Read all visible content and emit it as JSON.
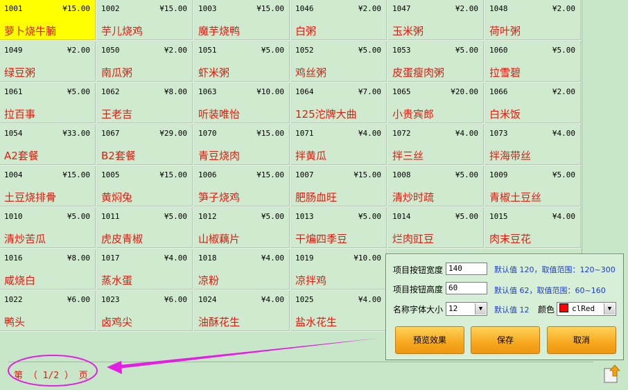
{
  "items": [
    {
      "code": "1001",
      "price": "¥15.00",
      "name": "萝卜烧牛腩",
      "selected": true
    },
    {
      "code": "1002",
      "price": "¥15.00",
      "name": "芋儿烧鸡"
    },
    {
      "code": "1003",
      "price": "¥15.00",
      "name": "魔芋烧鸭"
    },
    {
      "code": "1046",
      "price": "¥2.00",
      "name": "白粥"
    },
    {
      "code": "1047",
      "price": "¥2.00",
      "name": "玉米粥"
    },
    {
      "code": "1048",
      "price": "¥2.00",
      "name": "荷叶粥"
    },
    {
      "code": "1049",
      "price": "¥2.00",
      "name": "绿豆粥"
    },
    {
      "code": "1050",
      "price": "¥2.00",
      "name": "南瓜粥"
    },
    {
      "code": "1051",
      "price": "¥5.00",
      "name": "虾米粥"
    },
    {
      "code": "1052",
      "price": "¥5.00",
      "name": "鸡丝粥"
    },
    {
      "code": "1053",
      "price": "¥5.00",
      "name": "皮蛋瘦肉粥"
    },
    {
      "code": "1060",
      "price": "¥5.00",
      "name": "拉雪碧"
    },
    {
      "code": "1061",
      "price": "¥5.00",
      "name": "拉百事"
    },
    {
      "code": "1062",
      "price": "¥8.00",
      "name": "王老吉"
    },
    {
      "code": "1063",
      "price": "¥10.00",
      "name": "听装唯怡"
    },
    {
      "code": "1064",
      "price": "¥7.00",
      "name": "125沱牌大曲"
    },
    {
      "code": "1065",
      "price": "¥20.00",
      "name": "小贵宾郎"
    },
    {
      "code": "1066",
      "price": "¥2.00",
      "name": "白米饭"
    },
    {
      "code": "1054",
      "price": "¥33.00",
      "name": "A2套餐"
    },
    {
      "code": "1067",
      "price": "¥29.00",
      "name": "B2套餐"
    },
    {
      "code": "1070",
      "price": "¥15.00",
      "name": "青豆烧肉"
    },
    {
      "code": "1071",
      "price": "¥4.00",
      "name": "拌黄瓜"
    },
    {
      "code": "1072",
      "price": "¥4.00",
      "name": "拌三丝"
    },
    {
      "code": "1073",
      "price": "¥4.00",
      "name": "拌海带丝"
    },
    {
      "code": "1004",
      "price": "¥15.00",
      "name": "土豆烧排骨"
    },
    {
      "code": "1005",
      "price": "¥15.00",
      "name": "黄焖兔"
    },
    {
      "code": "1006",
      "price": "¥15.00",
      "name": "笋子烧鸡"
    },
    {
      "code": "1007",
      "price": "¥15.00",
      "name": "肥肠血旺"
    },
    {
      "code": "1008",
      "price": "¥5.00",
      "name": "清炒时疏"
    },
    {
      "code": "1009",
      "price": "¥5.00",
      "name": "青椒土豆丝"
    },
    {
      "code": "1010",
      "price": "¥5.00",
      "name": "清炒苦瓜"
    },
    {
      "code": "1011",
      "price": "¥5.00",
      "name": "虎皮青椒"
    },
    {
      "code": "1012",
      "price": "¥5.00",
      "name": "山椒藕片"
    },
    {
      "code": "1013",
      "price": "¥5.00",
      "name": "干煸四季豆"
    },
    {
      "code": "1014",
      "price": "¥5.00",
      "name": "烂肉豇豆"
    },
    {
      "code": "1015",
      "price": "¥4.00",
      "name": "肉末豆花"
    },
    {
      "code": "1016",
      "price": "¥8.00",
      "name": "咸烧白"
    },
    {
      "code": "1017",
      "price": "¥4.00",
      "name": "蒸水蛋"
    },
    {
      "code": "1018",
      "price": "¥4.00",
      "name": "凉粉"
    },
    {
      "code": "1019",
      "price": "¥10.00",
      "name": "凉拌鸡"
    },
    {
      "code": "1022",
      "price": "¥6.00",
      "name": "鸭头"
    },
    {
      "code": "1023",
      "price": "¥6.00",
      "name": "卤鸡尖"
    },
    {
      "code": "1024",
      "price": "¥4.00",
      "name": "油酥花生"
    },
    {
      "code": "1025",
      "price": "¥4.00",
      "name": "盐水花生"
    }
  ],
  "pager": {
    "text": "第 （ 1/2 ） 页"
  },
  "settings": {
    "width_label": "项目按钮宽度",
    "width_value": "140",
    "width_hint": "默认值 120，取值范围：120~300",
    "height_label": "项目按钮高度",
    "height_value": "60",
    "height_hint": "默认值 62，取值范围：60~160",
    "font_label": "名称字体大小",
    "font_value": "12",
    "font_hint": "默认值 12",
    "color_label": "颜色",
    "color_value": "clRed",
    "color_swatch": "#ff0000",
    "preview_label": "预览效果",
    "save_label": "保存",
    "cancel_label": "取消"
  },
  "colors": {
    "background": "#c8e6c8",
    "selected_tile": "#ffff00",
    "item_name": "#e31b0f",
    "hint_text": "#1a3ad8",
    "annotation": "#e21fe2",
    "button": "#f6a81e"
  },
  "icons": {
    "export": "export-arrow-icon"
  }
}
